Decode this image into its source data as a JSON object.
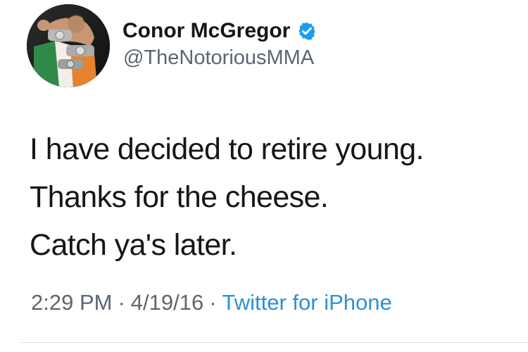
{
  "tweet": {
    "author": {
      "display_name": "Conor McGregor",
      "handle": "@TheNotoriousMMA",
      "verified": true,
      "verified_icon": "verified-badge-icon",
      "avatar": "profile-photo"
    },
    "text_lines": [
      "I have decided to retire young.",
      "Thanks for the cheese.",
      "Catch ya's later."
    ],
    "meta": {
      "time": "2:29 PM",
      "separator": "·",
      "date": "4/19/16",
      "source": "Twitter for iPhone"
    }
  },
  "colors": {
    "text_primary": "#14171a",
    "text_secondary": "#5b6670",
    "link_blue": "#2f8fd8",
    "verified_blue": "#1d9bf0",
    "divider": "#d8dde1"
  }
}
